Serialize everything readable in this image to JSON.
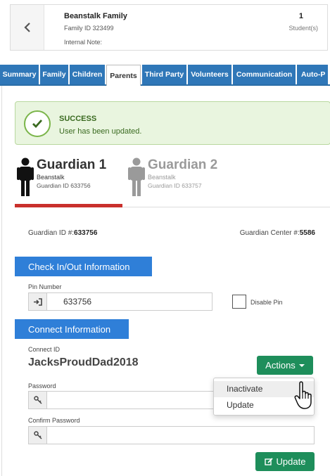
{
  "family": {
    "name": "Beanstalk Family",
    "id_label": "Family ID 323499",
    "note_label": "Internal Note:",
    "student_count": "1",
    "students_label": "Student(s)"
  },
  "tabs": [
    {
      "label": "Summary",
      "active": false
    },
    {
      "label": "Family",
      "active": false
    },
    {
      "label": "Children",
      "active": false
    },
    {
      "label": "Parents",
      "active": true
    },
    {
      "label": "Third Party",
      "active": false
    },
    {
      "label": "Volunteers",
      "active": false
    },
    {
      "label": "Communication",
      "active": false
    },
    {
      "label": "Auto-P",
      "active": false
    }
  ],
  "alert": {
    "title": "SUCCESS",
    "message": "User has been updated.",
    "color": "#3a6a20"
  },
  "guardians": [
    {
      "title": "Guardian 1",
      "last_name": "Beanstalk",
      "id_text": "Guardian ID 633756",
      "active": true
    },
    {
      "title": "Guardian 2",
      "last_name": "Beanstalk",
      "id_text": "Guardian ID 633757",
      "active": false
    }
  ],
  "guardian_info": {
    "id_prefix": "Guardian ID #:",
    "id_value": "633756",
    "center_prefix": "Guardian Center #:",
    "center_value": "5586"
  },
  "checkin": {
    "header": "Check In/Out Information",
    "pin_label": "Pin Number",
    "pin_value": "633756",
    "disable_pin_label": "Disable Pin",
    "disable_pin_checked": false
  },
  "connect": {
    "header": "Connect Information",
    "id_label": "Connect ID",
    "id_value": "JacksProudDad2018",
    "actions_label": "Actions",
    "menu": [
      "Inactivate",
      "Update"
    ],
    "password_label": "Password",
    "confirm_label": "Confirm Password",
    "update_label": "Update"
  },
  "colors": {
    "tab_blue": "#2f77b8",
    "section_blue": "#2f7fd8",
    "green_button": "#1e8e5b",
    "active_guardian_bar": "#c9302c"
  },
  "icons": [
    "chevron-left-icon",
    "check-icon",
    "person-icon",
    "sign-in-icon",
    "key-icon",
    "edit-icon",
    "hand-cursor-icon"
  ]
}
